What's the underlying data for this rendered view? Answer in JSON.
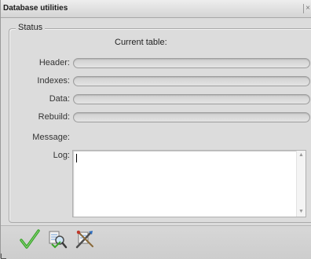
{
  "window": {
    "title": "Database utilities",
    "close_symbol": "×"
  },
  "status": {
    "legend": "Status",
    "current_table_label": "Current table:",
    "rows": [
      {
        "label": "Header:"
      },
      {
        "label": "Indexes:"
      },
      {
        "label": "Data:"
      },
      {
        "label": "Rebuild:"
      }
    ],
    "message_label": "Message:",
    "log_label": "Log:",
    "log_value": ""
  },
  "toolbar": {
    "icons": [
      "check-icon",
      "inspect-icon",
      "repair-icon"
    ]
  },
  "colors": {
    "accent_check": "#3aa62a",
    "background": "#dcdcdc"
  }
}
